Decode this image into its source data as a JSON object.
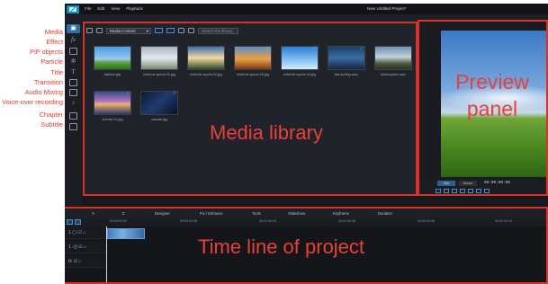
{
  "annotations": {
    "media": "Media",
    "effect": "Effect",
    "pip": "PiP objects",
    "particle": "Particle",
    "title": "Title",
    "transition": "Transition",
    "audio_mixing": "Audio Mixing",
    "voice_over": "Voice-over recording",
    "chapter": "Chapter",
    "subtitle": "Subtitle"
  },
  "window": {
    "menu": [
      "File",
      "Edit",
      "View",
      "Playback"
    ],
    "project_title": "New Untitled Project*"
  },
  "media_library": {
    "filter_label": "Media Content",
    "search_placeholder": "Search the library",
    "overlay_label": "Media library",
    "items": [
      {
        "name": "balloon.jpg"
      },
      {
        "name": "extreme sports 01.jpg"
      },
      {
        "name": "extreme sports 02.jpg"
      },
      {
        "name": "extreme sports 03.jpg"
      },
      {
        "name": "extreme sports 04.jpg"
      },
      {
        "name": "kite surfing.wmv"
      },
      {
        "name": "motorcycles.mpo"
      },
      {
        "name": "sunrise 01.jpg"
      },
      {
        "name": "canvas.jpg"
      }
    ]
  },
  "preview": {
    "overlay_label": "Preview panel",
    "clip_label": "Clip",
    "movie_label": "Movie",
    "timecode": "00:00:00:00"
  },
  "timeline": {
    "overlay_label": "Time line of project",
    "toolbar": [
      "Designer",
      "Fix / Enhance",
      "Tools",
      "Slideshow",
      "Keyframe",
      "Duration"
    ],
    "ruler": [
      "00:00:00:00",
      "00:00:03:08",
      "00:01:00:04",
      "00:01:30:06",
      "00:02:00:08",
      "00:02:30:10"
    ]
  },
  "colors": {
    "annotation": "#e23b2e",
    "highlight_border": "#d93228",
    "app_bg": "#16181d"
  }
}
